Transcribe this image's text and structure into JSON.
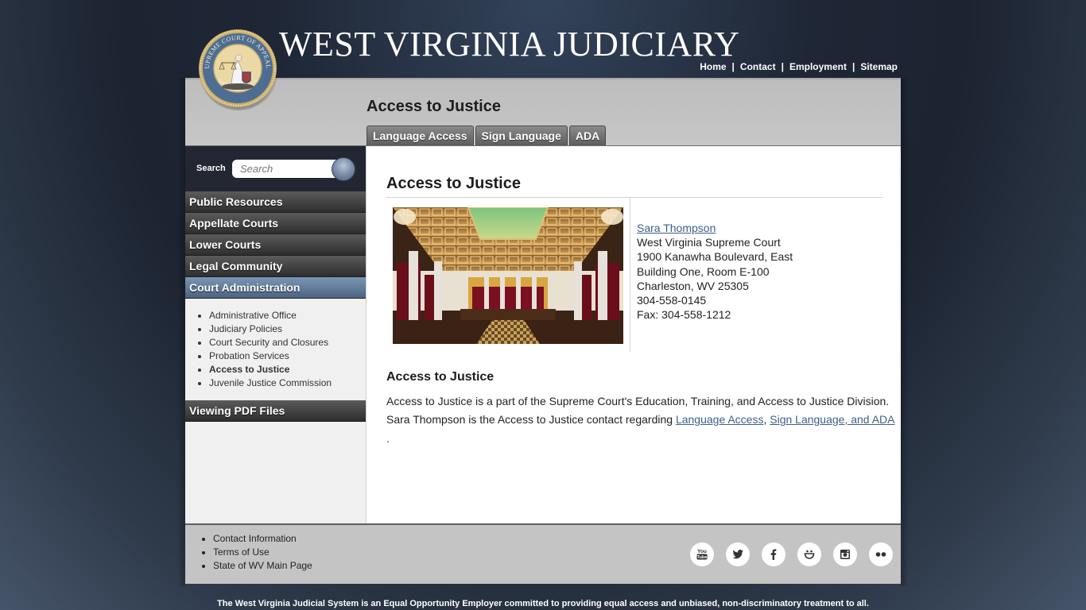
{
  "header": {
    "site_title": "WEST VIRGINIA JUDICIARY",
    "seal_alt": "Supreme Court of Appeals - West Virginia seal",
    "topnav": [
      {
        "label": "Home"
      },
      {
        "label": "Contact"
      },
      {
        "label": "Employment"
      },
      {
        "label": "Sitemap"
      }
    ],
    "separator": "|",
    "page_heading": "Access to Justice",
    "tabs": [
      {
        "label": "Language Access"
      },
      {
        "label": "Sign Language"
      },
      {
        "label": "ADA"
      }
    ]
  },
  "sidebar": {
    "search_label": "Search",
    "search_placeholder": "Search",
    "search_value": "",
    "nav": [
      {
        "label": "Public Resources",
        "active": false
      },
      {
        "label": "Appellate Courts",
        "active": false
      },
      {
        "label": "Lower Courts",
        "active": false
      },
      {
        "label": "Legal Community",
        "active": false
      },
      {
        "label": "Court Administration",
        "active": true
      }
    ],
    "subnav": [
      {
        "label": "Administrative Office"
      },
      {
        "label": "Judiciary Policies"
      },
      {
        "label": "Court Security and Closures"
      },
      {
        "label": "Probation Services"
      },
      {
        "label": "Access to Justice",
        "current": true
      },
      {
        "label": "Juvenile Justice Commission"
      }
    ],
    "extra_nav": [
      {
        "label": "Viewing PDF Files"
      }
    ]
  },
  "main": {
    "title": "Access to Justice",
    "photo_alt": "West Virginia Supreme Court courtroom",
    "contact": {
      "name": "Sara Thompson",
      "lines": [
        "West Virginia Supreme Court",
        "1900 Kanawha Boulevard, East",
        "Building One, Room E-100",
        "Charleston, WV 25305",
        "304-558-0145",
        "Fax: 304-558-1212"
      ]
    },
    "section_title": "Access to Justice",
    "paragraph_1": "Access to Justice is a part of the Supreme Court's Education, Training, and Access to Justice Division.",
    "paragraph_2_prefix": "Sara Thompson is the Access to Justice contact regarding ",
    "link_1": "Language Access",
    "link_sep": ", ",
    "link_2": "Sign Language, and ADA",
    "trailing": "."
  },
  "footer": {
    "links": [
      {
        "label": "Contact Information"
      },
      {
        "label": "Terms of Use"
      },
      {
        "label": "State of WV Main Page"
      }
    ],
    "social": [
      {
        "icon": "youtube-icon"
      },
      {
        "icon": "twitter-icon"
      },
      {
        "icon": "facebook-icon"
      },
      {
        "icon": "smugmug-icon"
      },
      {
        "icon": "instagram-icon"
      },
      {
        "icon": "flickr-icon"
      }
    ],
    "eoe_statement": "The West Virginia Judicial System is an Equal Opportunity Employer committed to providing equal access and unbiased, non-discriminatory treatment to all."
  },
  "colors": {
    "link": "#3d5f8a",
    "active_nav": "#5f7a9c",
    "background": "#1f2736"
  }
}
